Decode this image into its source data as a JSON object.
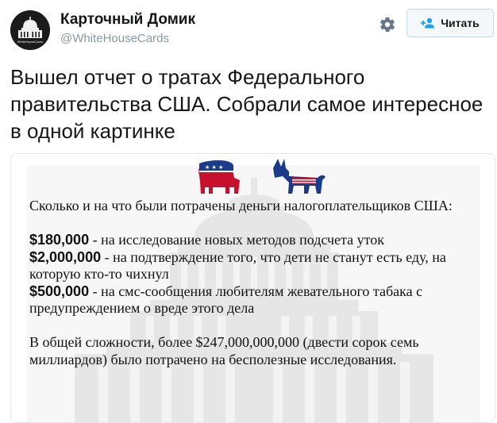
{
  "account": {
    "name": "Карточный Домик",
    "handle": "@WhiteHouseCards",
    "avatar_icon": "white-house-icon",
    "avatar_caption": "WhiteHouseCards"
  },
  "actions": {
    "gear_icon": "gear-icon",
    "follow_label": "Читать",
    "follow_icon": "add-person-icon"
  },
  "tweet": {
    "text": "Вышел отчет о тратах Федерального правительства США. Собрали самое интересное в одной картинке"
  },
  "image": {
    "icons": [
      "republican-elephant-icon",
      "democrat-donkey-icon",
      "capitol-icon"
    ],
    "intro": "Сколько и на что были потрачены деньги налогоплательщиков США:",
    "items": [
      {
        "amount": "$180,000",
        "text": " - на исследование новых методов подсчета уток"
      },
      {
        "amount": "$2,000,000",
        "text": " - на подтверждение того, что дети не станут есть еду, на которую кто-то чихнул"
      },
      {
        "amount": "$500,000",
        "text": " - на смс-сообщения любителям жевательного табака с предупреждением о вреде этого дела"
      }
    ],
    "summary": "В общей сложности, более $247,000,000,000 (двести сорок семь миллиардов) было потрачено на бесполезные исследования."
  },
  "colors": {
    "text": "#14171a",
    "handle": "#8899a6",
    "link_blue": "#1da1f2",
    "gop_red": "#c8102e",
    "dem_blue": "#1a3a8a"
  }
}
